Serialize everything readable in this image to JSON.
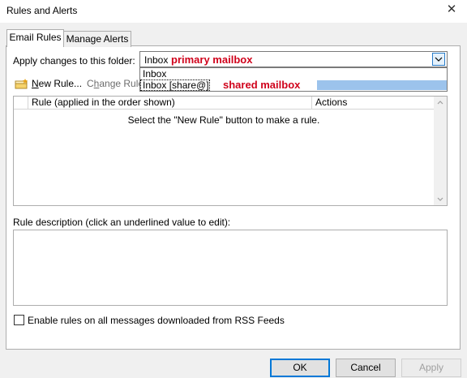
{
  "window": {
    "title": "Rules and Alerts"
  },
  "tabs": [
    {
      "label": "Email Rules",
      "active": true
    },
    {
      "label": "Manage Alerts",
      "active": false
    }
  ],
  "folder": {
    "label": "Apply changes to this folder:",
    "selected_value": "Inbox",
    "annotation": "primary mailbox",
    "options": [
      "Inbox",
      "Inbox [share@]"
    ],
    "option_annotation": "shared mailbox"
  },
  "toolbar": {
    "new_rule": {
      "accel": "N",
      "rest": "ew Rule..."
    },
    "change_rule": {
      "accel": "h",
      "pre": "C",
      "rest": "ange Rule"
    }
  },
  "rules_table": {
    "columns": [
      "Rule (applied in the order shown)",
      "Actions"
    ],
    "empty_message": "Select the \"New Rule\" button to make a rule."
  },
  "description": {
    "label": "Rule description (click an underlined value to edit):"
  },
  "rss": {
    "label": "Enable rules on all messages downloaded from RSS Feeds",
    "checked": false
  },
  "buttons": {
    "ok": "OK",
    "cancel": "Cancel",
    "apply": "Apply"
  },
  "colors": {
    "annotation": "#d0021b",
    "highlight": "#9cc3ec",
    "ok_border": "#0078d7"
  }
}
